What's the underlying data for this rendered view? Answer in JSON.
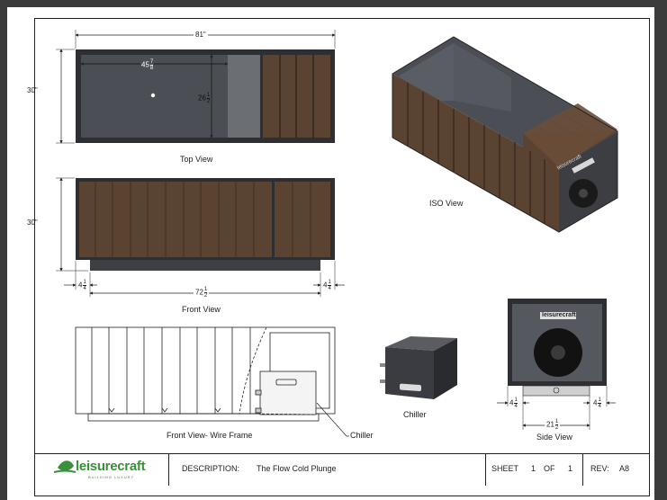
{
  "views": {
    "top": "Top View",
    "iso": "ISO View",
    "front": "Front View",
    "wire": "Front View- Wire Frame",
    "chiller": "Chiller",
    "side": "Side View"
  },
  "dimensions": {
    "overall_length": "81\"",
    "height_top": "30\"",
    "height_front": "30\"",
    "inner_length_whole": "45",
    "inner_length_num": "7",
    "inner_length_den": "8",
    "inner_width_whole": "26",
    "inner_width_num": "1",
    "inner_width_den": "2",
    "base_length_whole": "72",
    "base_length_num": "1",
    "base_length_den": "2",
    "left_offset_whole": "4",
    "right_offset_whole": "4",
    "offset_num": "1",
    "offset_den": "4",
    "side_left_whole": "4",
    "side_right_whole": "4",
    "side_width_whole": "21",
    "side_width_num": "1",
    "side_width_den": "2"
  },
  "callouts": {
    "chiller": "Chiller"
  },
  "brand": {
    "logo_text": "leisurecraft",
    "logo_tagline": "BUILDING LUXURY",
    "logo_color": "#3a8f3a",
    "unit_badge": "leisurecraft"
  },
  "title_block": {
    "description_label": "DESCRIPTION:",
    "description_value": "The Flow Cold Plunge",
    "sheet_label": "SHEET",
    "sheet_num": "1",
    "of_label": "OF",
    "sheet_total": "1",
    "rev_label": "REV:",
    "rev_value": "A8"
  },
  "colors": {
    "wood": "#5b4331",
    "wood_dark": "#3f2e22",
    "tub_interior": "#4b4e54",
    "frame_dark": "#2e2f33",
    "panel_gray": "#6b6e73"
  }
}
